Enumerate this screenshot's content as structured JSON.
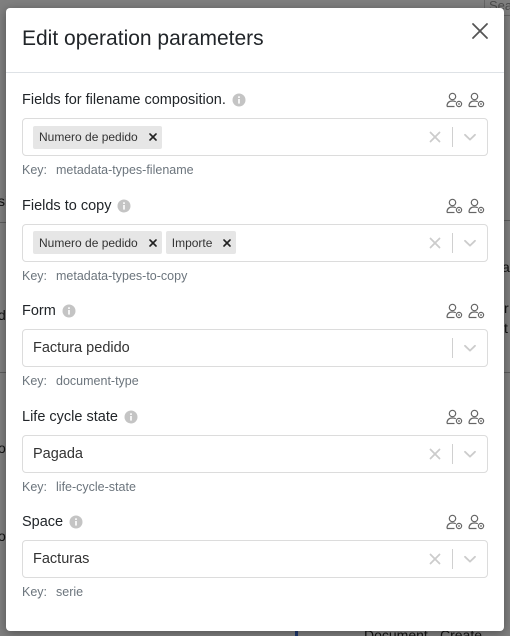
{
  "background": {
    "search_fragment": "Sear",
    "fragments": [
      "si",
      "d",
      "at",
      "r",
      "t",
      "o",
      "o",
      "Document",
      "Create"
    ]
  },
  "modal": {
    "title": "Edit operation parameters",
    "close_icon": "close-icon",
    "fields": [
      {
        "label": "Fields for filename composition.",
        "type": "multi",
        "tags": [
          "Numero de pedido"
        ],
        "value": "",
        "clearable": true,
        "key_label": "Key:",
        "key_value": "metadata-types-filename"
      },
      {
        "label": "Fields to copy",
        "type": "multi",
        "tags": [
          "Numero de pedido",
          "Importe"
        ],
        "value": "",
        "clearable": true,
        "key_label": "Key:",
        "key_value": "metadata-types-to-copy"
      },
      {
        "label": "Form",
        "type": "single",
        "tags": [],
        "value": "Factura pedido",
        "clearable": false,
        "key_label": "Key:",
        "key_value": "document-type"
      },
      {
        "label": "Life cycle state",
        "type": "single",
        "tags": [],
        "value": "Pagada",
        "clearable": true,
        "key_label": "Key:",
        "key_value": "life-cycle-state"
      },
      {
        "label": "Space",
        "type": "single",
        "tags": [],
        "value": "Facturas",
        "clearable": true,
        "key_label": "Key:",
        "key_value": "serie"
      }
    ]
  },
  "colors": {
    "text": "#212529",
    "muted": "#6c757d",
    "border": "#dcdcdc",
    "tag_bg": "#e6e6e6",
    "icon_gray": "#999999"
  },
  "icons": {
    "info": "info-icon",
    "user_settings": "user-gear-icon",
    "clear": "clear-icon",
    "dropdown": "chevron-down-icon",
    "tag_remove": "tag-remove-icon"
  }
}
